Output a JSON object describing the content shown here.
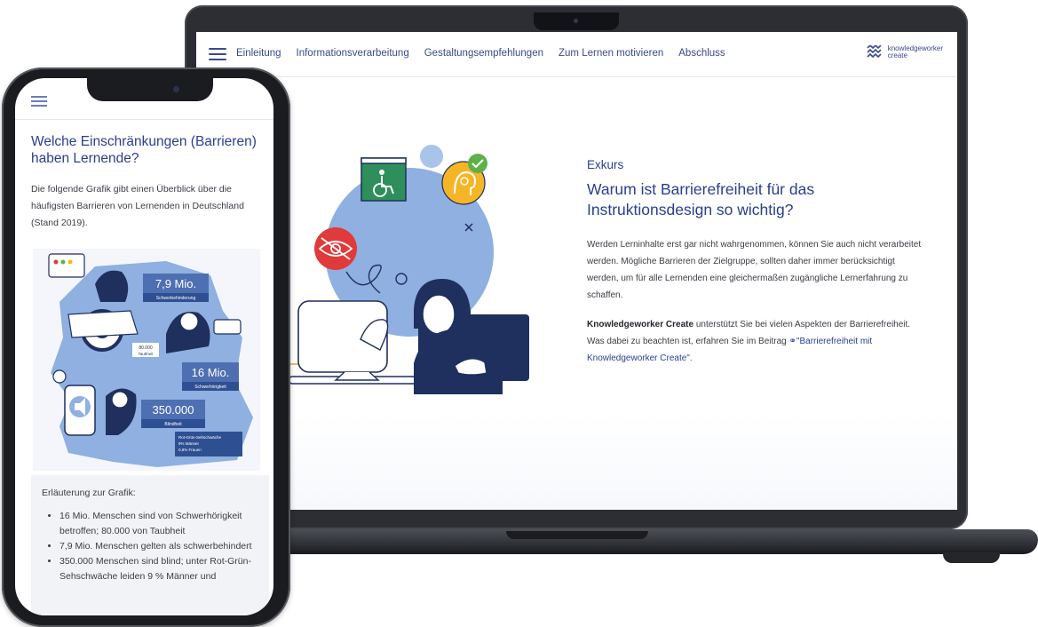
{
  "laptop": {
    "nav": {
      "items": [
        "Einleitung",
        "Informationsverarbeitung",
        "Gestaltungsempfehlungen",
        "Zum Lernen motivieren",
        "Abschluss"
      ],
      "brand_line1": "knowledgeworker",
      "brand_line2": "create"
    },
    "exkurs": {
      "label": "Exkurs",
      "title": "Warum ist Barrierefreiheit für das Instruktionsdesign so wichtig?",
      "paragraph1": "Werden Lerninhalte erst gar nicht wahrgenommen, können Sie auch nicht verarbeitet werden. Mögliche Barrieren der Zielgruppe, sollten daher immer berücksichtigt werden, um für alle Lernenden eine gleichermaßen zugängliche Lernerfahrung zu schaffen.",
      "paragraph2_bold": "Knowledgeworker Create",
      "paragraph2_text": " unterstützt Sie bei vielen Aspekten der Barrierefreiheit. Was dabei zu beachten ist, erfahren Sie im Beitrag ",
      "link_text": "\"Barrierefreiheit mit Knowledgeworker Create\"",
      "link_suffix": "."
    }
  },
  "phone": {
    "title": "Welche Einschränkungen (Barrieren) haben Lernende?",
    "intro": "Die folgende Grafik gibt einen Überblick über die häufigsten Barrieren von Lernenden in Deutschland (Stand 2019).",
    "graphic": {
      "stat1_value": "7,9 Mio.",
      "stat1_label": "Schwerbehinderung",
      "stat2_value": "80.000",
      "stat2_label": "Taubheit",
      "stat3_value": "16 Mio.",
      "stat3_label": "Schwerhörigkeit",
      "stat4_value": "350.000",
      "stat4_label": "Blindheit",
      "stat5_line1": "Rot-Grün-Sehschwäche",
      "stat5_line2": "9% Männer",
      "stat5_line3": "0,8% Frauen"
    },
    "explanation": {
      "title": "Erläuterung zur Grafik:",
      "items": [
        "16 Mio. Menschen sind von Schwerhörigkeit betroffen; 80.000 von Taubheit",
        "7,9 Mio. Menschen gelten als schwerbehindert",
        "350.000 Menschen sind blind; unter Rot-Grün-Sehschwäche leiden 9 % Männer und"
      ]
    }
  },
  "colors": {
    "accent": "#2a3f8f",
    "illustration_blue": "#8fb0e0",
    "navy": "#1f2f5e",
    "green": "#2e8f5a",
    "red": "#e03a3a",
    "yellow": "#f5b526"
  },
  "icons": [
    "hamburger-icon",
    "wheelchair-icon",
    "brain-icon",
    "eye-icon",
    "check-icon",
    "close-icon"
  ]
}
